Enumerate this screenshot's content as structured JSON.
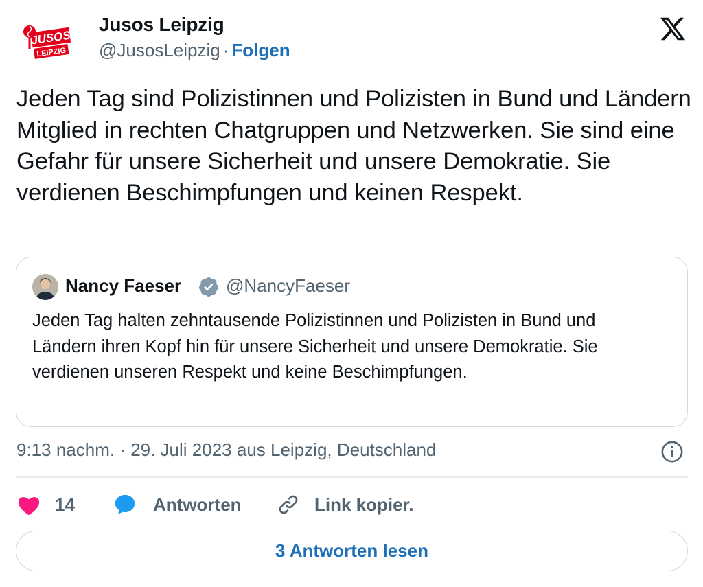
{
  "tweet": {
    "author": {
      "name": "Jusos Leipzig",
      "handle": "@JusosLeipzig",
      "separator": "·",
      "follow_label": "Folgen",
      "logo_text_top": "JUSOS",
      "logo_text_bottom": "LEIPZIG"
    },
    "text": "Jeden Tag sind Polizistinnen und Polizisten in Bund und Ländern Mitglied in rechten Chatgruppen und Netzwerken. Sie sind eine Gefahr für unsere Sicherheit und unsere Demokratie. Sie verdienen Beschimpfungen und keinen Respekt.",
    "quoted": {
      "name": "Nancy Faeser",
      "handle": "@NancyFaeser",
      "verified": true,
      "text": "Jeden Tag halten zehntausende Polizistinnen und Polizisten in Bund und Ländern ihren Kopf hin für unsere Sicherheit und unsere Demokratie. Sie verdienen unseren Respekt und keine Beschimpfungen."
    },
    "timestamp": "9:13 nachm. · 29. Juli 2023 aus Leipzig, Deutschland",
    "actions": {
      "like_count": "14",
      "reply_label": "Antworten",
      "copy_link_label": "Link kopier."
    },
    "read_replies_label": "3 Antworten lesen"
  },
  "colors": {
    "text": "#0f1419",
    "secondary": "#536471",
    "link": "#1d6fb8",
    "like": "#f91880",
    "reply": "#1d9bf0",
    "border": "#cfd9de",
    "logo_red": "#e2001a",
    "verified_gray": "#829aab"
  },
  "icons": {
    "platform": "x-logo-icon",
    "like": "heart-icon",
    "reply": "speech-bubble-icon",
    "copy": "link-icon",
    "info": "info-icon",
    "verified": "verified-badge-icon"
  }
}
